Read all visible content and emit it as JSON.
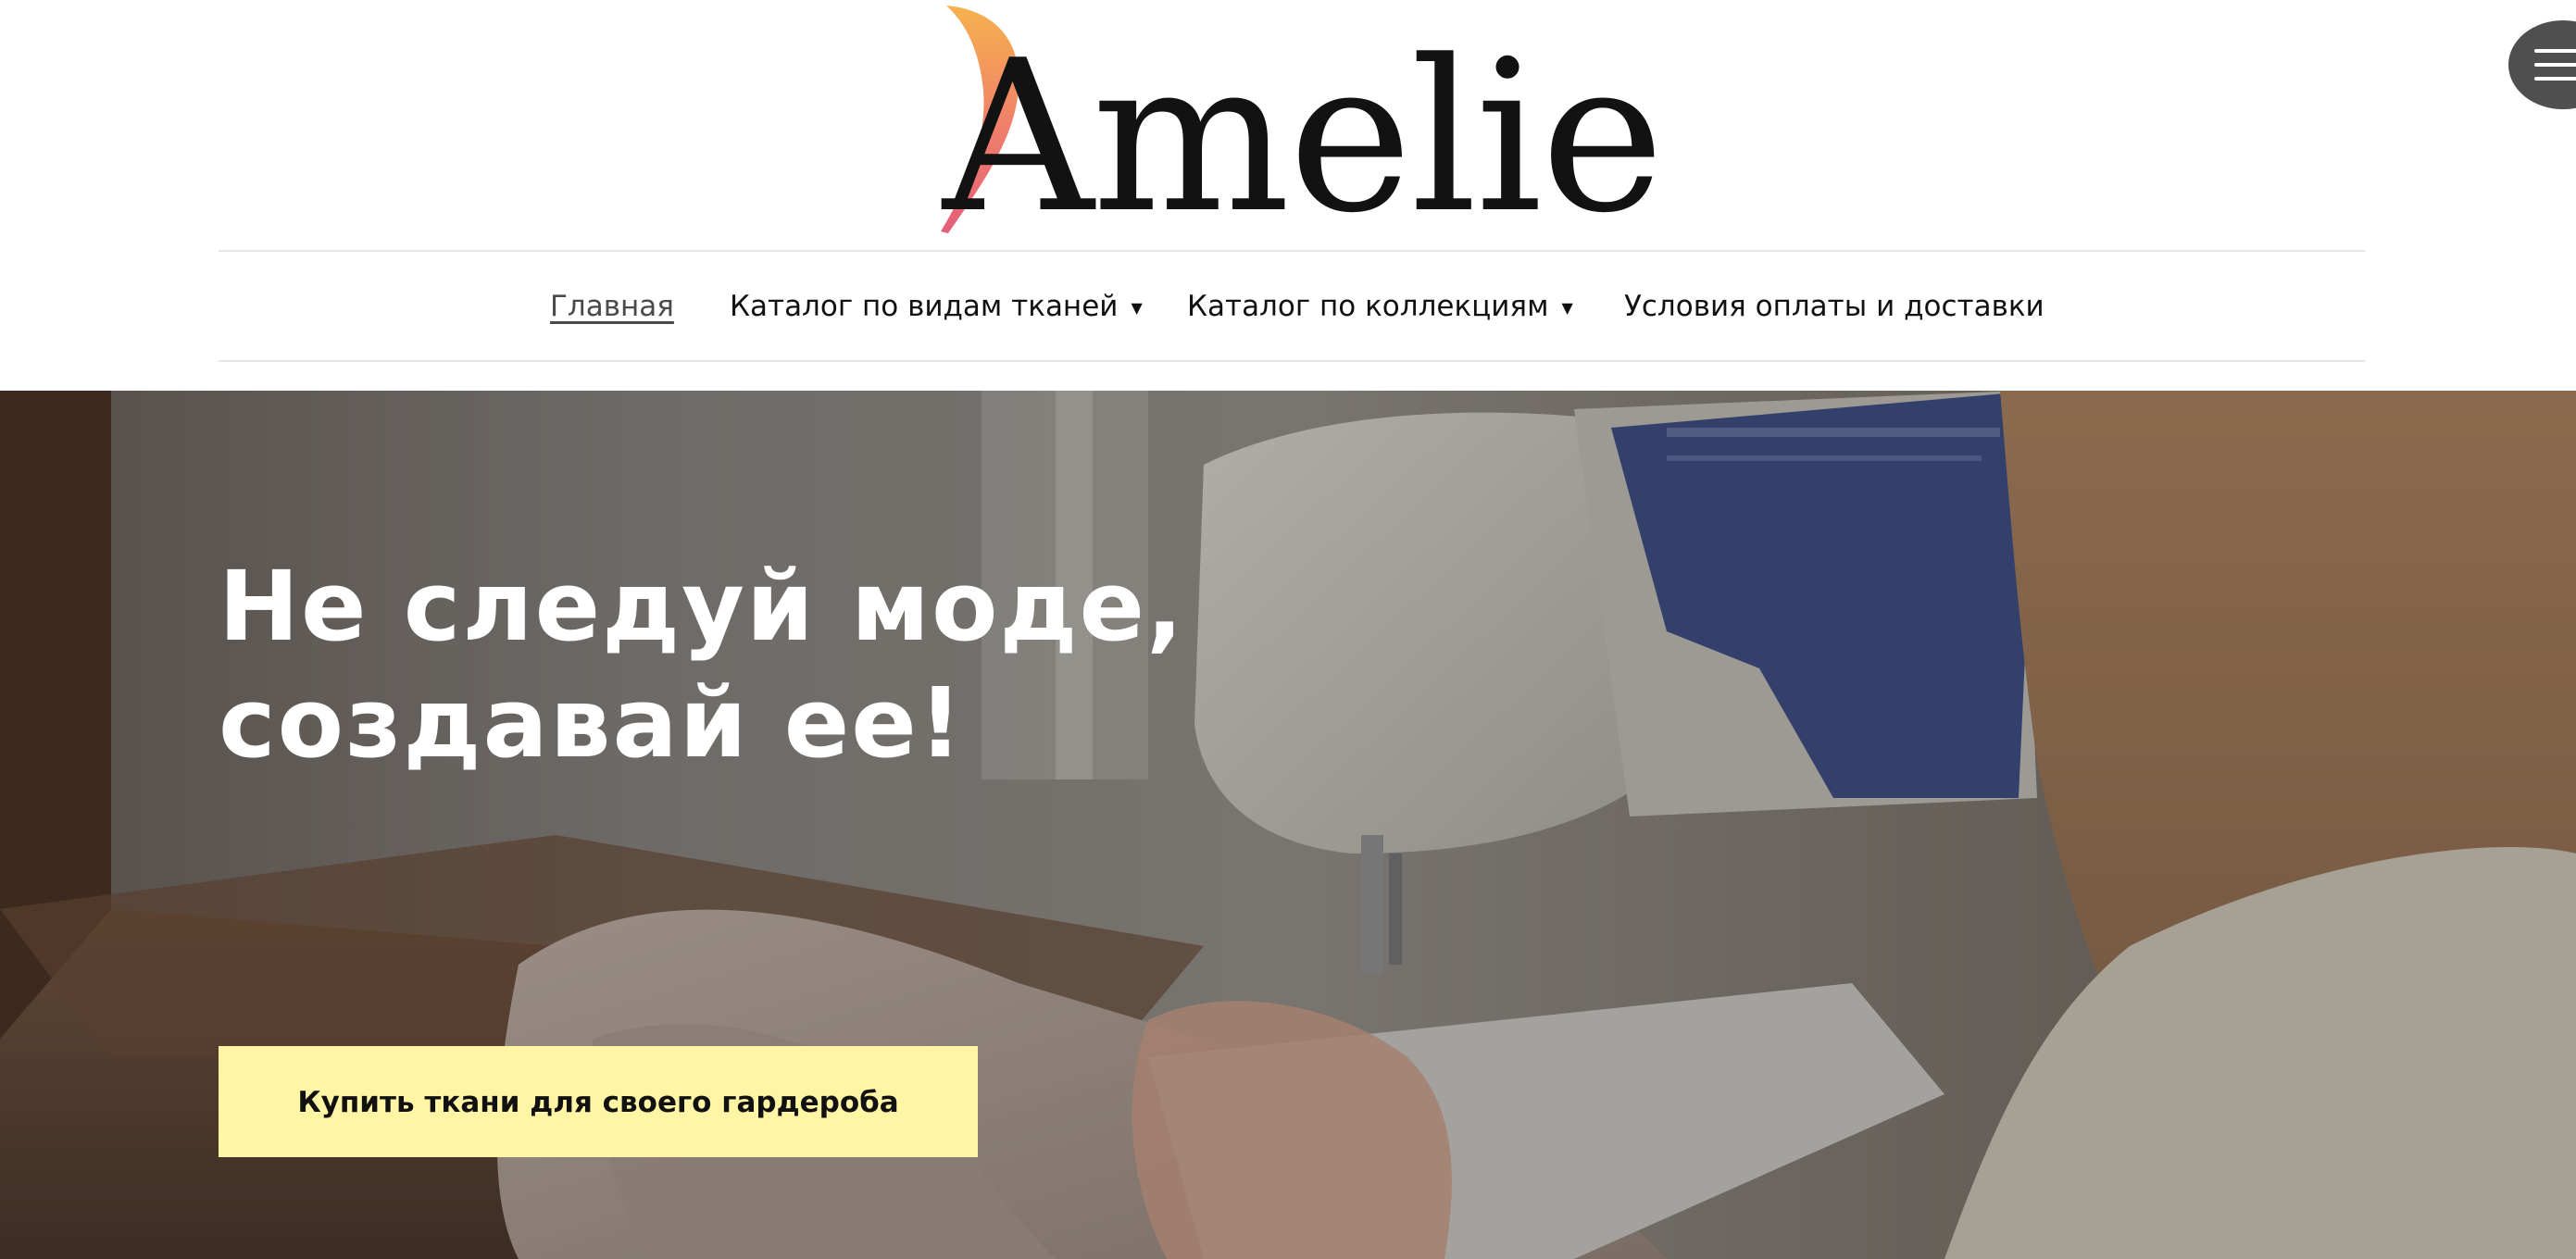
{
  "brand": {
    "logo_text": "Amelie",
    "flame_colors": [
      "#f6b24e",
      "#f07e6b",
      "#e25f7a"
    ]
  },
  "menu_button": {
    "icon": "hamburger-icon",
    "color": "#4f4f4f"
  },
  "nav": {
    "items": [
      {
        "label": "Главная",
        "active": true
      },
      {
        "label": "Каталог по видам тканей",
        "has_dropdown": true
      },
      {
        "label": "Каталог по коллекциям",
        "has_dropdown": true
      },
      {
        "label": "Условия оплаты и доставки"
      }
    ],
    "dropdown_icon": "caret-down-icon"
  },
  "hero": {
    "title_line1": "Не следуй моде,",
    "title_line2": "создавай ее!",
    "cta_label": "Купить ткани для своего гардероба",
    "cta_color": "#fff5a5",
    "image": "sewing-machine-photo"
  }
}
